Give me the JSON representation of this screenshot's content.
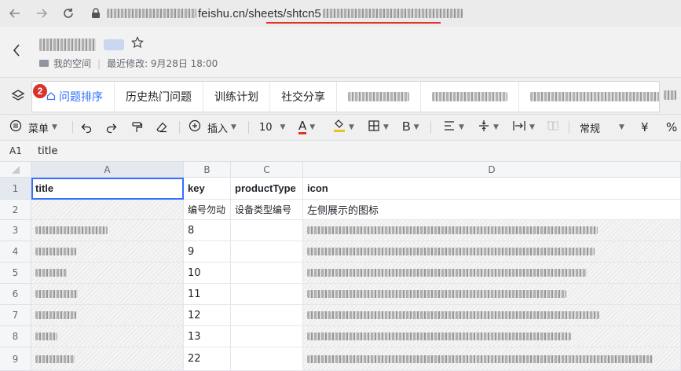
{
  "browser": {
    "url_visible_start": "feishu.cn/sheets/shtcn5",
    "marker_1": "1",
    "marker_2": "2"
  },
  "doc": {
    "breadcrumb_folder": "我的空间",
    "last_modified": "最近修改: 9月28日 18:00"
  },
  "sheet_tabs": [
    {
      "label": "问题排序",
      "active": true
    },
    {
      "label": "历史热门问题",
      "active": false
    },
    {
      "label": "训练计划",
      "active": false
    },
    {
      "label": "社交分享",
      "active": false
    }
  ],
  "toolbar": {
    "menu_label": "菜单",
    "insert_label": "插入",
    "font_size": "10",
    "font_color_glyph": "A",
    "bold_glyph": "B",
    "number_format": "常规",
    "currency_glyph": "¥",
    "percent_glyph": "%"
  },
  "formula_bar": {
    "cell_ref": "A1",
    "content": "title"
  },
  "grid": {
    "columns": [
      "A",
      "B",
      "C",
      "D"
    ],
    "row_numbers": [
      "1",
      "2",
      "3",
      "4",
      "5",
      "6",
      "7",
      "8",
      "9"
    ],
    "header_row": [
      "title",
      "key",
      "productType",
      "icon"
    ],
    "description_row": [
      "",
      "编号勿动",
      "设备类型编号",
      "左侧展示的图标"
    ],
    "key_values": [
      "8",
      "9",
      "10",
      "11",
      "12",
      "13",
      "22"
    ]
  },
  "colors": {
    "accent": "#3370ff",
    "marker": "#d9322b"
  },
  "icons": [
    "back-arrow-icon",
    "forward-arrow-icon",
    "reload-icon",
    "lock-icon",
    "chevron-left-icon",
    "star-icon",
    "folder-icon",
    "layers-icon",
    "home-icon",
    "menu-icon",
    "undo-icon",
    "redo-icon",
    "format-painter-icon",
    "eraser-icon",
    "insert-icon",
    "font-color-icon",
    "fill-color-icon",
    "border-icon",
    "align-icon",
    "vertical-align-icon",
    "text-wrap-icon",
    "merge-icon"
  ]
}
